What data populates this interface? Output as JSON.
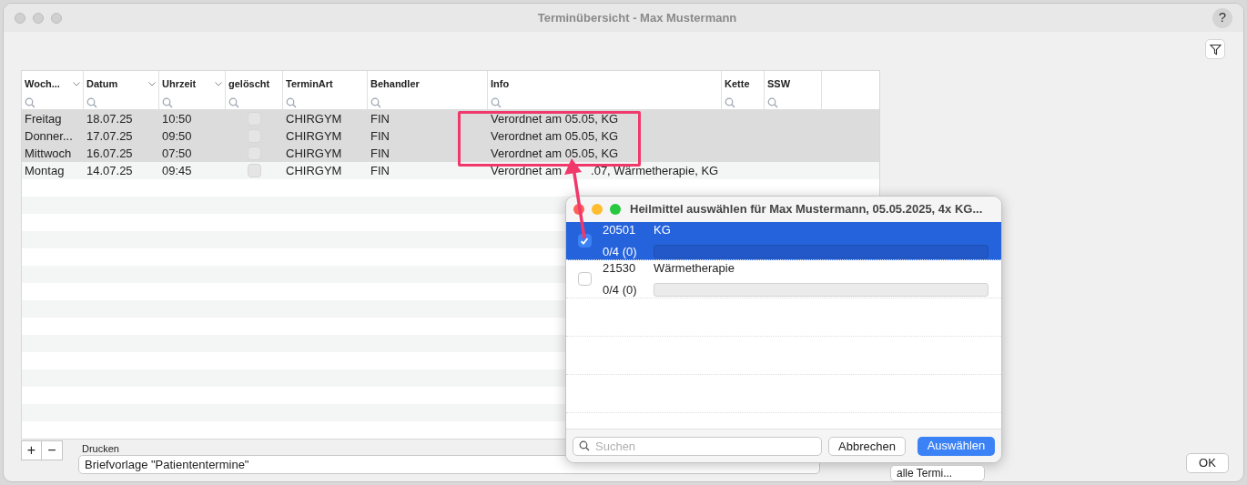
{
  "window": {
    "title": "Terminübersicht - Max Mustermann",
    "help": "?"
  },
  "table": {
    "columns": [
      {
        "label": "Woch...",
        "menu": true
      },
      {
        "label": "Datum",
        "menu": true
      },
      {
        "label": "Uhrzeit",
        "menu": true
      },
      {
        "label": "gelöscht",
        "menu": false
      },
      {
        "label": "TerminArt",
        "menu": false
      },
      {
        "label": "Behandler",
        "menu": false
      },
      {
        "label": "Info",
        "menu": false
      },
      {
        "label": "Kette",
        "menu": false
      },
      {
        "label": "SSW",
        "menu": false
      }
    ],
    "rows": [
      {
        "cells": [
          "Freitag",
          "18.07.25",
          "10:50",
          "",
          "CHIRGYM",
          "FIN",
          [
            "Verordnet am 05.05, KG"
          ]
        ],
        "deleted": false,
        "selected": true
      },
      {
        "cells": [
          "Donner...",
          "17.07.25",
          "09:50",
          "",
          "CHIRGYM",
          "FIN",
          [
            "Verordnet am 05.05, KG"
          ]
        ],
        "deleted": false,
        "selected": true
      },
      {
        "cells": [
          "Mittwoch",
          "16.07.25",
          "07:50",
          "",
          "CHIRGYM",
          "FIN",
          [
            "Verordnet am 05.05, KG"
          ]
        ],
        "deleted": false,
        "selected": true
      },
      {
        "cells": [
          "Montag",
          "14.07.25",
          "09:45",
          "",
          "CHIRGYM",
          "FIN",
          [
            "Verordnet am",
            ".07, Wärmetherapie, KG"
          ]
        ],
        "deleted": false,
        "selected": false
      }
    ]
  },
  "bottom": {
    "add": "+",
    "remove": "−",
    "print_label": "Drucken",
    "template": "Briefvorlage \"Patiententermine\"",
    "filter_select": "alle Termi...",
    "ok": "OK"
  },
  "dialog": {
    "title": "Heilmittel auswählen für Max Mustermann, 05.05.2025, 4x KG...",
    "items": [
      {
        "code": "20501",
        "name": "KG",
        "count": "0/4 (0)",
        "level": 0,
        "checked": true,
        "selected": true
      },
      {
        "code": "21530",
        "name": "Wärmetherapie",
        "count": "0/4 (0)",
        "level": 0,
        "checked": false,
        "selected": false
      }
    ],
    "search": {
      "placeholder": "Suchen"
    },
    "cancel": "Abbrechen",
    "confirm": "Auswählen"
  }
}
